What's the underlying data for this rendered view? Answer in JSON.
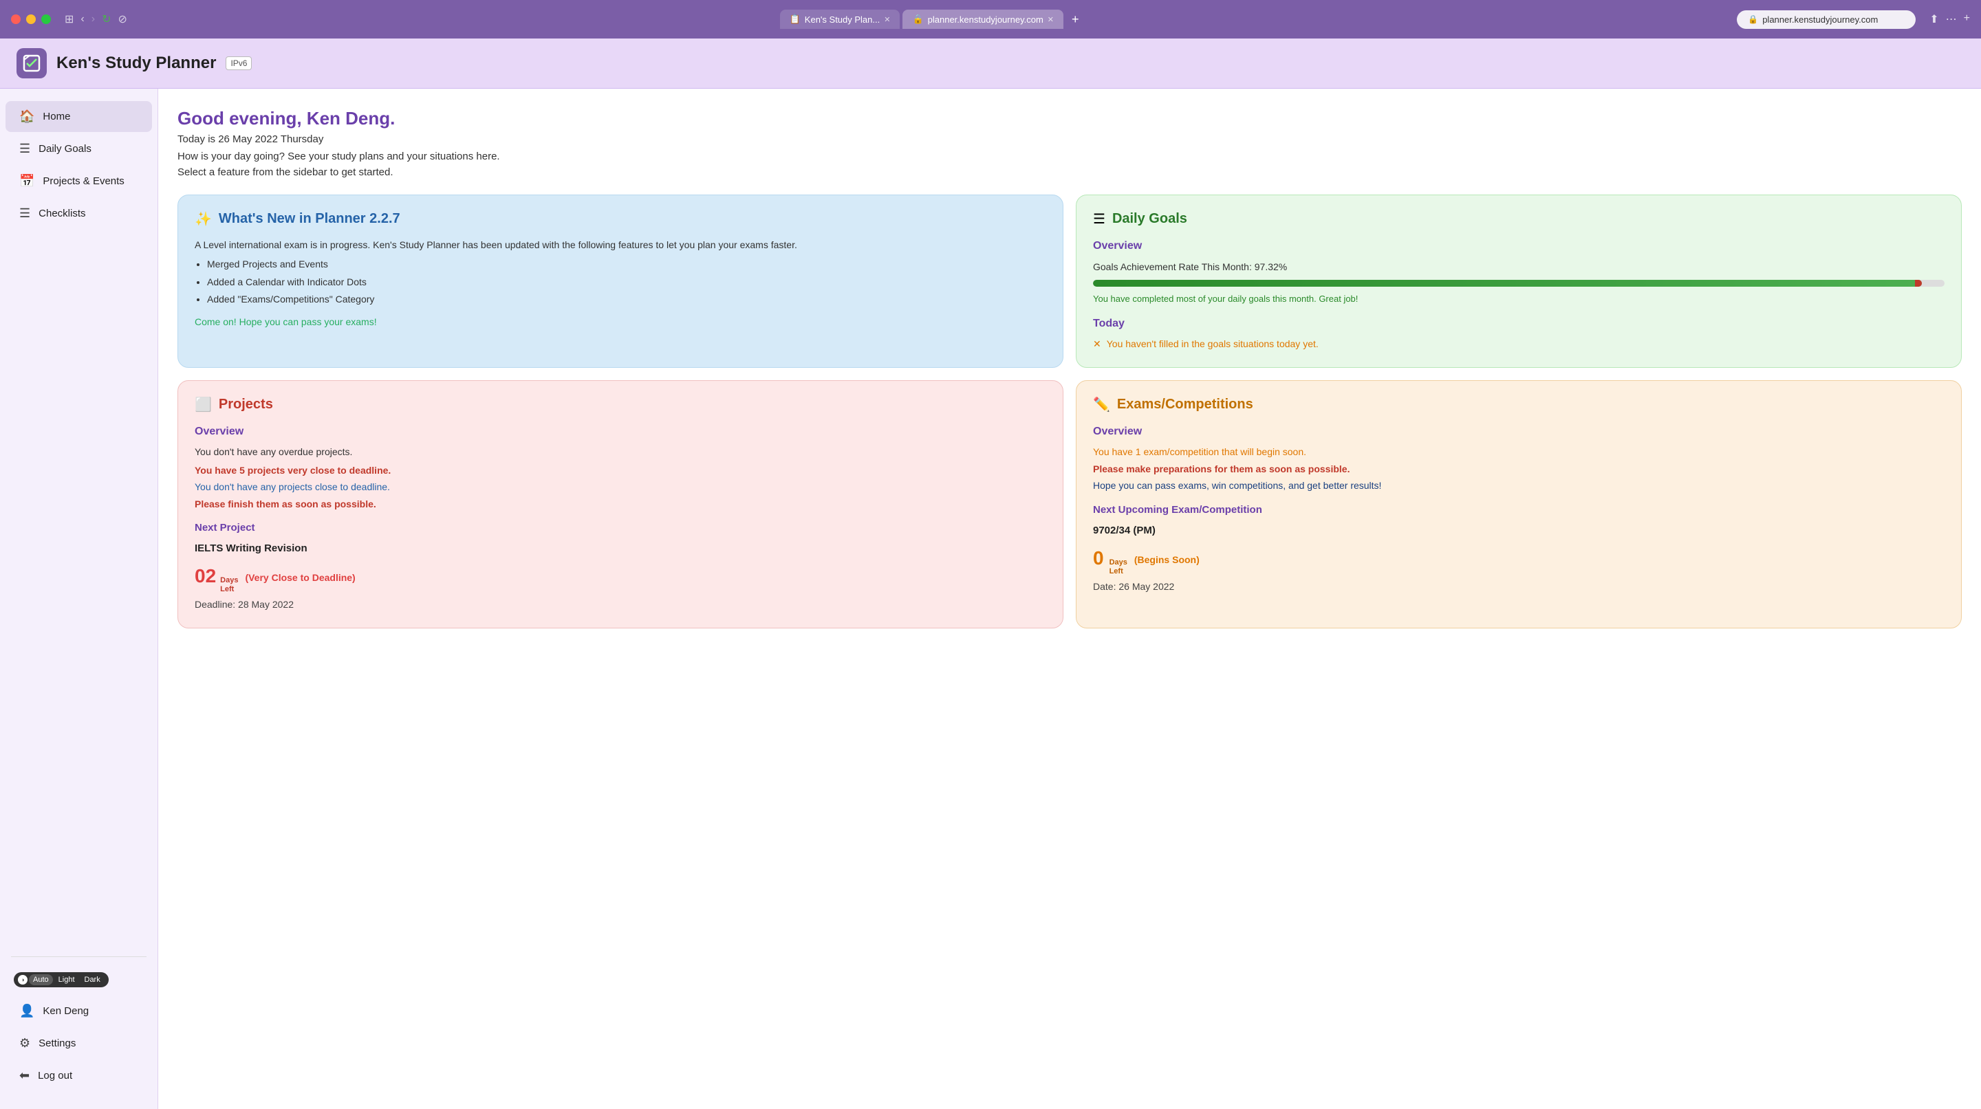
{
  "browser": {
    "tabs": [
      {
        "label": "Ken's Study Plan...",
        "active": false,
        "icon": "📋"
      },
      {
        "label": "planner.kenstudyjourney.com",
        "active": true,
        "icon": "🔒"
      }
    ],
    "address": "planner.kenstudyjourney.com"
  },
  "header": {
    "title": "Ken's Study Planner",
    "badge": "IPv6"
  },
  "sidebar": {
    "items": [
      {
        "label": "Home",
        "icon": "🏠",
        "active": true
      },
      {
        "label": "Daily Goals",
        "icon": "☰",
        "active": false
      },
      {
        "label": "Projects & Events",
        "icon": "📅",
        "active": false
      },
      {
        "label": "Checklists",
        "icon": "☰",
        "active": false
      }
    ],
    "theme": {
      "label": "",
      "options": [
        "Auto",
        "Light",
        "Dark"
      ],
      "selected": "Auto"
    },
    "user": "Ken Deng",
    "settings": "Settings",
    "logout": "Log out"
  },
  "main": {
    "greeting": "Good evening, Ken Deng.",
    "date": "Today is 26 May 2022 Thursday",
    "subtitle": "How is your day going? See your study plans and your situations here.",
    "instruction": "Select a feature from the sidebar to get started.",
    "cards": {
      "whats_new": {
        "title": "What's New in Planner 2.2.7",
        "body": "A Level international exam is in progress. Ken's Study Planner has been updated with the following features to let you plan your exams faster.",
        "bullets": [
          "Merged Projects and Events",
          "Added a Calendar with Indicator Dots",
          "Added \"Exams/Competitions\" Category"
        ],
        "cta": "Come on! Hope you can pass your exams!"
      },
      "daily_goals": {
        "title": "Daily Goals",
        "overview_label": "Overview",
        "achievement_label": "Goals Achievement Rate This Month: 97.32%",
        "progress": 97.32,
        "motivation": "You have completed most of your daily goals this month. Great job!",
        "today_label": "Today",
        "today_warning": "✕ You haven't filled in the goals situations today yet."
      },
      "projects": {
        "title": "Projects",
        "overview_label": "Overview",
        "no_overdue": "You don't have any overdue projects.",
        "very_close_warning": "You have 5 projects very close to deadline.",
        "no_close": "You don't have any projects close to deadline.",
        "finish_soon": "Please finish them as soon as possible.",
        "next_label": "Next Project",
        "next_name": "IELTS Writing Revision",
        "days_left": "02",
        "days_left_label": "Days\nLeft",
        "urgency": "(Very Close to Deadline)",
        "deadline": "Deadline: 28 May 2022"
      },
      "exams": {
        "title": "Exams/Competitions",
        "overview_label": "Overview",
        "begins_soon": "You have 1 exam/competition that will begin soon.",
        "prepare": "Please make preparations for them as soon as possible.",
        "hope": "Hope you can pass exams, win competitions, and get better results!",
        "next_label": "Next Upcoming Exam/Competition",
        "next_name": "9702/34 (PM)",
        "days_left": "0",
        "days_left_label": "Days\nLeft",
        "urgency": "(Begins Soon)",
        "date": "Date: 26 May 2022"
      }
    }
  }
}
